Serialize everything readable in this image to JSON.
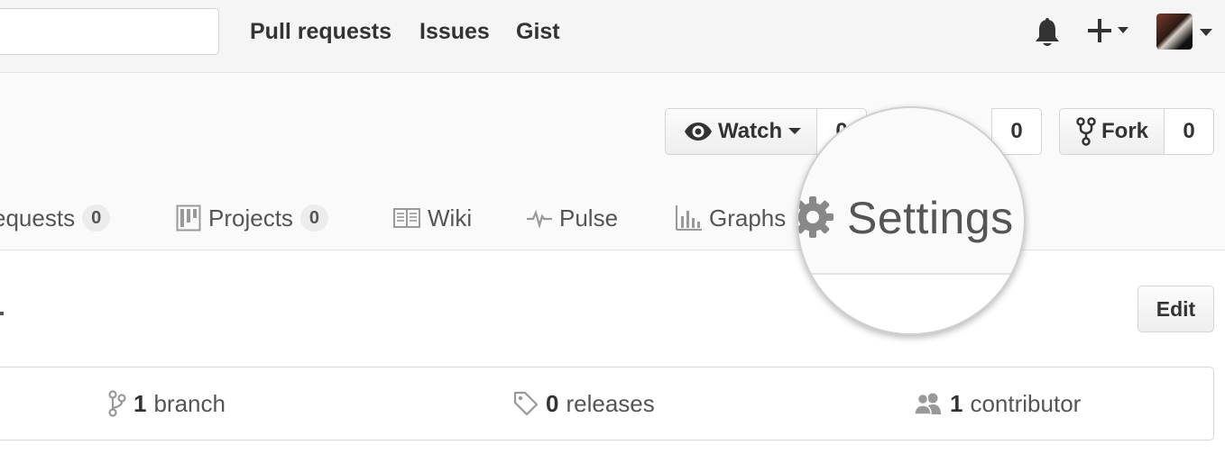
{
  "header": {
    "search_placeholder": "",
    "nav": {
      "pull_requests": "Pull requests",
      "issues": "Issues",
      "gist": "Gist"
    },
    "icons": [
      "bell-icon",
      "plus-icon",
      "avatar"
    ]
  },
  "repo_actions": {
    "watch_label": "Watch",
    "watch_count": "0",
    "star_count": "0",
    "fork_label": "Fork",
    "fork_count": "0"
  },
  "tabs": [
    {
      "label": "equests",
      "count": "0"
    },
    {
      "label": "Projects",
      "count": "0"
    },
    {
      "label": "Wiki"
    },
    {
      "label": "Pulse"
    },
    {
      "label": "Graphs"
    },
    {
      "label": "Settings"
    }
  ],
  "content": {
    "edit_label": "Edit",
    "stats": {
      "branches_count": "1",
      "branches_label": "branch",
      "releases_count": "0",
      "releases_label": "releases",
      "contributors_count": "1",
      "contributors_label": "contributor"
    }
  },
  "colors": {
    "header_bg": "#f5f5f5",
    "text": "#333333",
    "muted": "#555555",
    "border": "#d5d5d5"
  }
}
